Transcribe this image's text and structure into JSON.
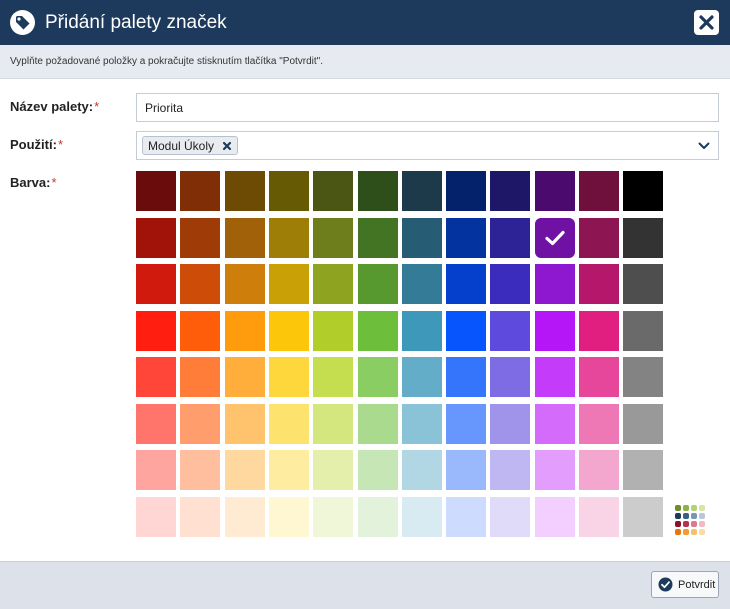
{
  "dialog": {
    "title": "Přidání palety značek",
    "subtitle": "Vyplňte požadované položky a pokračujte stisknutím tlačítka \"Potvrdit\"."
  },
  "form": {
    "name_label": "Název palety:",
    "name_value": "Priorita",
    "usage_label": "Použití:",
    "usage_chip": "Modul Úkoly",
    "color_label": "Barva:",
    "required_mark": "*"
  },
  "palette": {
    "selected_row": 1,
    "selected_col": 9,
    "rows": [
      [
        "#6b0c0c",
        "#7f2e06",
        "#6e4b05",
        "#675a04",
        "#4b5614",
        "#2f4f1a",
        "#1c3a4a",
        "#03226b",
        "#1e1667",
        "#4a0a6e",
        "#6f0f3b",
        "#000000"
      ],
      [
        "#a11208",
        "#9e3b07",
        "#a06108",
        "#9e7e06",
        "#6e7e1c",
        "#437424",
        "#275d74",
        "#03339e",
        "#2d2296",
        "#6f12a4",
        "#8d1552",
        "#333333"
      ],
      [
        "#d01a0e",
        "#cd4c08",
        "#ce7e0b",
        "#c9a107",
        "#8ea320",
        "#57982f",
        "#337b96",
        "#0440cc",
        "#3b2cbd",
        "#8e17d0",
        "#b5176b",
        "#4e4e4e"
      ],
      [
        "#ff1e0f",
        "#ff5d0a",
        "#ff9c0d",
        "#fcc60a",
        "#b1cd29",
        "#6dbf3b",
        "#3e98b9",
        "#0755fc",
        "#5e4bdd",
        "#b416f8",
        "#e01f80",
        "#6a6a6a"
      ],
      [
        "#ff4638",
        "#ff7c39",
        "#ffae3b",
        "#fdd73c",
        "#c4de50",
        "#8acd62",
        "#64adc8",
        "#3575fb",
        "#7e6ce4",
        "#c43cf9",
        "#e6479b",
        "#838383"
      ],
      [
        "#ff756b",
        "#ff9d6c",
        "#ffc36e",
        "#fde26d",
        "#d4e77f",
        "#a9da8d",
        "#8ac3d8",
        "#6797fc",
        "#9f93ea",
        "#d56bfa",
        "#ee78b5",
        "#999999"
      ],
      [
        "#ffa59f",
        "#ffbf9e",
        "#ffd8a0",
        "#feeda0",
        "#e3efab",
        "#c6e6b5",
        "#b1d6e4",
        "#9ab9fd",
        "#bfb7f1",
        "#e39dfc",
        "#f4a7ce",
        "#b1b1b1"
      ],
      [
        "#ffd6d3",
        "#ffe0d1",
        "#ffebd2",
        "#fff6d2",
        "#f0f7d8",
        "#e3f3db",
        "#d8ebf2",
        "#cddcfe",
        "#dfdbf8",
        "#f2cffe",
        "#f9d4e7",
        "#cccccc"
      ]
    ]
  },
  "icons": {
    "header": "tag-icon",
    "close": "close-icon",
    "chip_remove": "remove-x-icon",
    "dropdown": "chevron-down-icon",
    "selected": "check-icon",
    "palette_switch": "palette-grid-icon",
    "confirm": "check-circle-icon"
  },
  "footer": {
    "confirm_label": "Potvrdit"
  }
}
